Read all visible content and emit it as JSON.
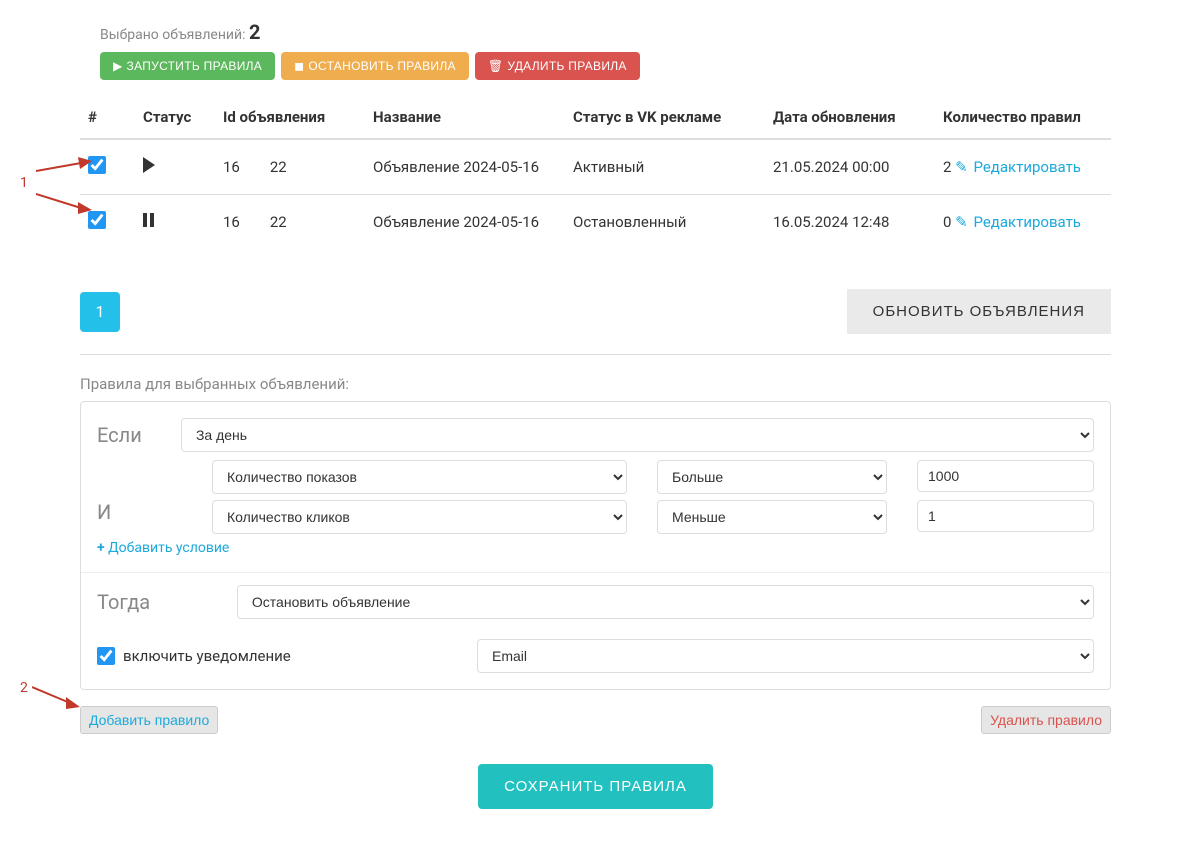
{
  "header": {
    "selected_label": "Выбрано объявлений:",
    "selected_count": "2",
    "run_btn": "ЗАПУСТИТЬ ПРАВИЛА",
    "stop_btn": "ОСТАНОВИТЬ ПРАВИЛА",
    "delete_btn": "УДАЛИТЬ ПРАВИЛА"
  },
  "table": {
    "columns": [
      "#",
      "Статус",
      "Id объявления",
      "Название",
      "Статус в VK рекламе",
      "Дата обновления",
      "Количество правил"
    ],
    "rows": [
      {
        "checked": true,
        "status": "play",
        "id_left": "16",
        "id_right": "22",
        "name": "Объявление 2024-05-16",
        "vk_status": "Активный",
        "updated": "21.05.2024 00:00",
        "rule_count": "2",
        "edit": "Редактировать"
      },
      {
        "checked": true,
        "status": "pause",
        "id_left": "16",
        "id_right": "22",
        "name": "Объявление 2024-05-16",
        "vk_status": "Остановленный",
        "updated": "16.05.2024 12:48",
        "rule_count": "0",
        "edit": "Редактировать"
      }
    ]
  },
  "pagination": {
    "page": "1"
  },
  "refresh_btn": "ОБНОВИТЬ ОБЪЯВЛЕНИЯ",
  "rules_title": "Правила для выбранных объявлений:",
  "rules": {
    "if_label": "Если",
    "period_select": "За день",
    "and_label": "И",
    "conditions": [
      {
        "metric": "Количество показов",
        "op": "Больше",
        "value": "1000"
      },
      {
        "metric": "Количество кликов",
        "op": "Меньше",
        "value": "1"
      }
    ],
    "add_condition": "Добавить условие",
    "then_label": "Тогда",
    "action_select": "Остановить объявление",
    "notify_label": "включить уведомление",
    "notify_channel": "Email"
  },
  "buttons": {
    "add_rule": "Добавить правило",
    "delete_rule": "Удалить правило",
    "save_rules": "СОХРАНИТЬ ПРАВИЛА"
  },
  "annotations": {
    "one": "1",
    "two": "2"
  }
}
